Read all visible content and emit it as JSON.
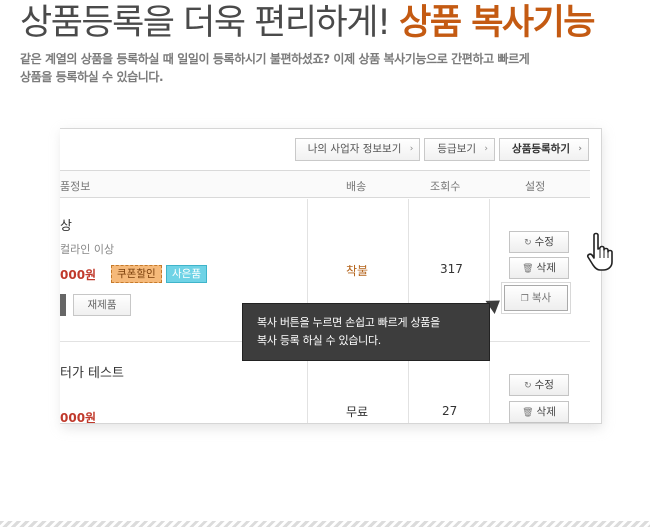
{
  "headline": {
    "plain": "상품등록을 더욱 편리하게!",
    "accent": "상품 복사기능",
    "accent_color": "#c45a12"
  },
  "description": {
    "line1": "같은 계열의 상품을 등록하실 때 일일이 등록하시기 불편하셨죠? 이제 상품 복사기능으로 간편하고 빠르게",
    "line2": "상품을 등록하실 수 있습니다."
  },
  "top_buttons": [
    {
      "label": "나의 사업자 정보보기",
      "chevron": "›"
    },
    {
      "label": "등급보기",
      "chevron": "›"
    },
    {
      "label": "상품등록하기",
      "chevron": "›"
    }
  ],
  "table": {
    "headers": {
      "info": "품정보",
      "shipping": "배송",
      "views": "조회수",
      "settings": "설정"
    },
    "rows": [
      {
        "name": "상",
        "option": "컬라인 이상",
        "price": "000원",
        "coupon_tag": "쿠폰할인",
        "gift_tag": "사은품",
        "restock_button": "재제품",
        "shipping": "착불",
        "shipping_color": "#b5651d",
        "views": "317",
        "edit_button": "수정",
        "delete_button": "삭제",
        "copy_button": "복사"
      },
      {
        "name": "터가 테스트",
        "price": "000원",
        "shipping": "무료",
        "shipping_color": "#333333",
        "views": "27",
        "edit_button": "수정",
        "delete_button": "삭제"
      }
    ]
  },
  "tooltip": {
    "line1": "복사 버튼을 누르면 손쉽고 빠르게 상품을",
    "line2": "복사 등록 하실 수 있습니다."
  },
  "icons": {
    "edit": "refresh-icon",
    "delete": "trash-icon",
    "copy": "copy-icon",
    "cursor": "hand-pointer-icon"
  }
}
